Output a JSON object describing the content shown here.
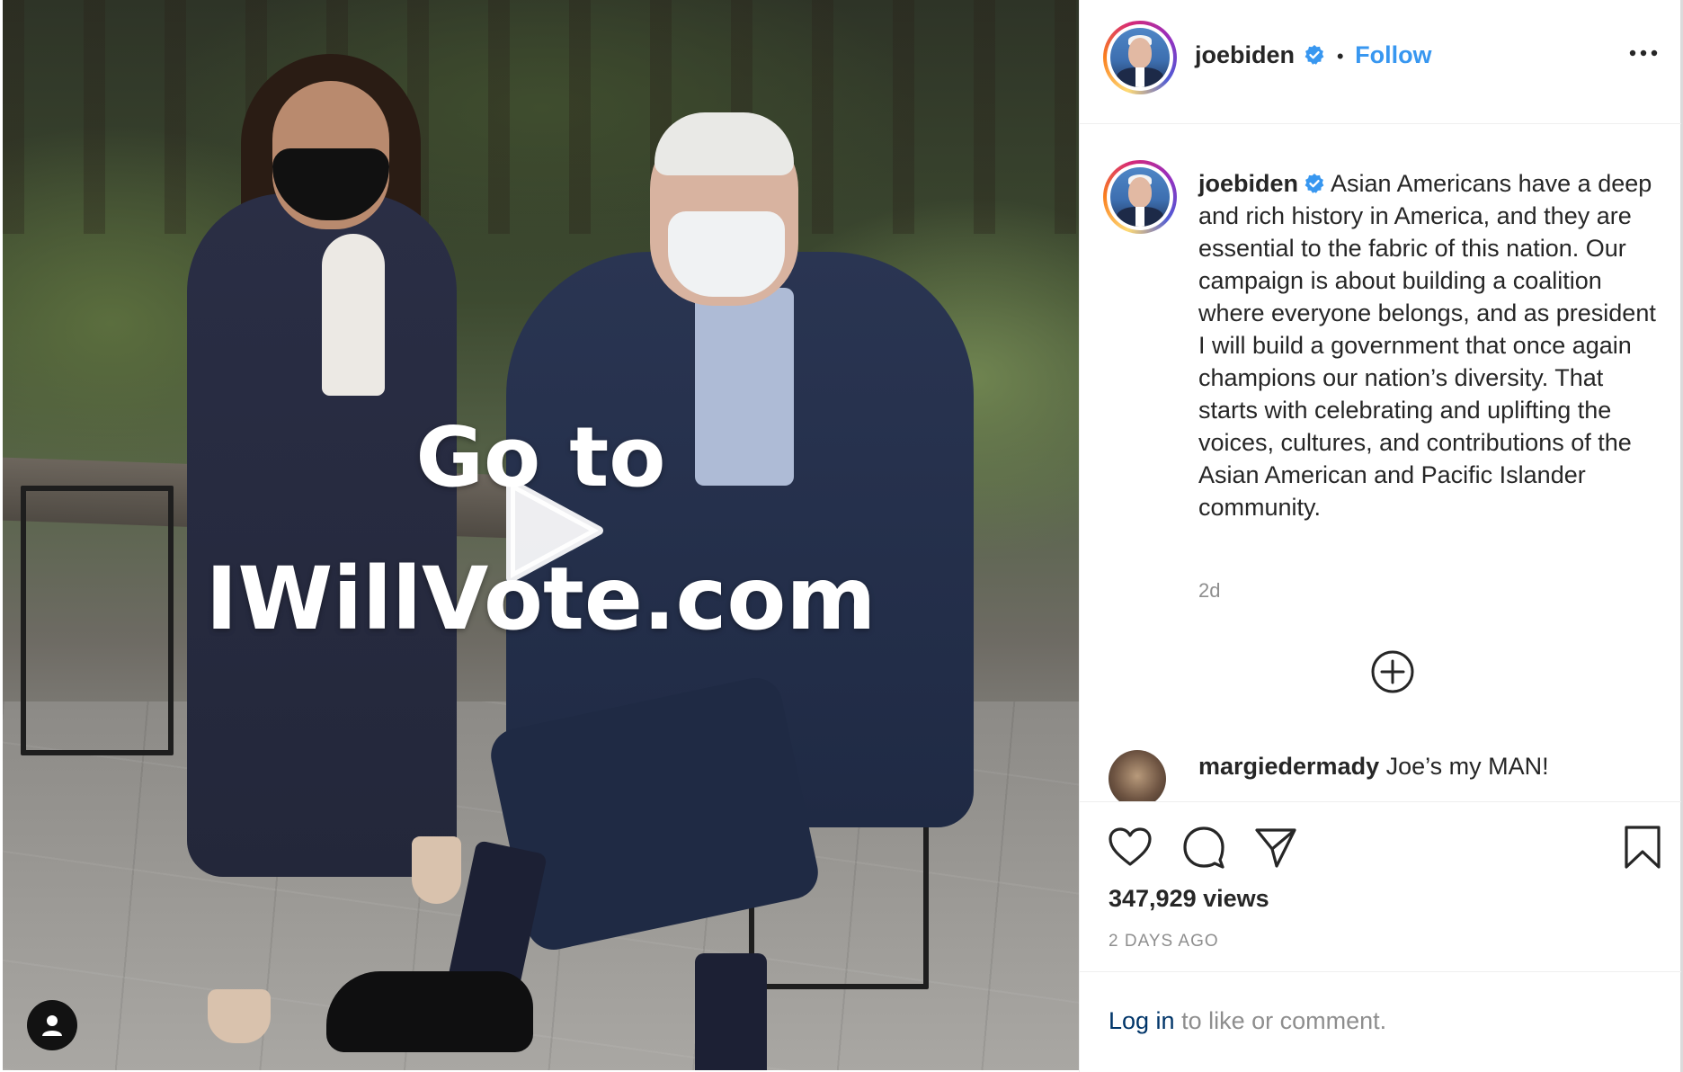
{
  "post": {
    "overlay_line1": "Go to",
    "overlay_line2": "IWillVote.com"
  },
  "header": {
    "username": "joebiden",
    "separator": "•",
    "follow_label": "Follow",
    "more_icon": "more-options-icon"
  },
  "caption": {
    "username": "joebiden",
    "text": "Asian Americans have a deep and rich history in America, and they are essential to the fabric of this nation. Our campaign is about building a coalition where everyone belongs, and as president I will build a government that once again champions our nation’s diversity.  That starts with celebrating and uplifting the voices, cultures, and contributions of the Asian American and Pacific Islander community.",
    "time_ago": "2d"
  },
  "comments": [
    {
      "username": "margiedermady",
      "text": "Joe’s my MAN!"
    }
  ],
  "actions": {
    "icons": [
      "heart-icon",
      "comment-icon",
      "share-icon",
      "bookmark-icon"
    ],
    "views": "347,929 views",
    "date": "2 DAYS AGO"
  },
  "login": {
    "link_label": "Log in",
    "suffix": " to like or comment."
  },
  "colors": {
    "accent": "#3897f0",
    "muted": "#8e8e8e",
    "text": "#262626",
    "link_dark": "#003569"
  }
}
